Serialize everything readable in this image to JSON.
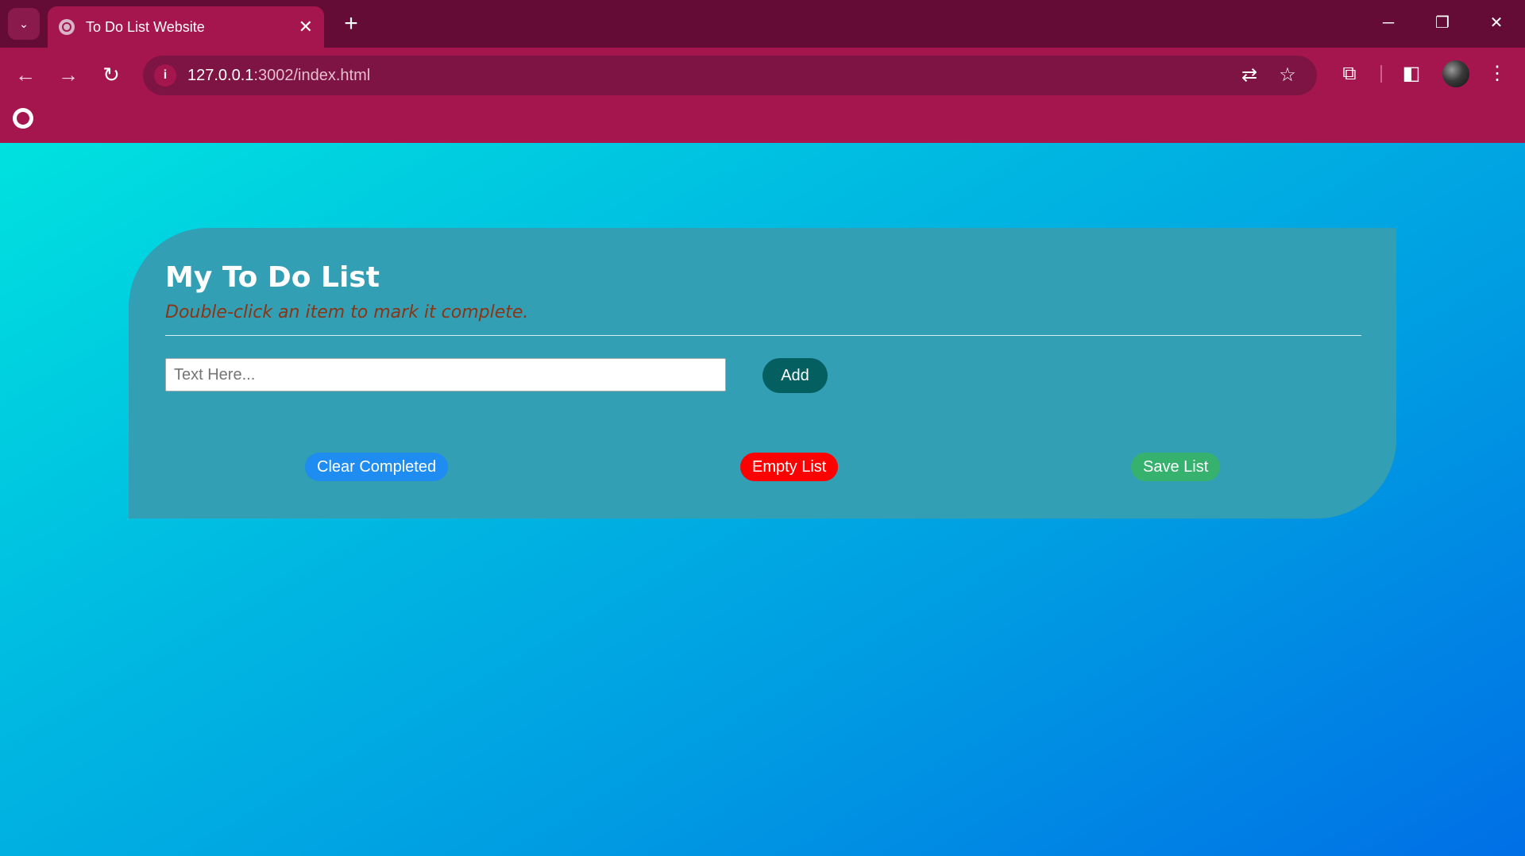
{
  "browser": {
    "tab_title": "To Do List Website",
    "tab_close": "✕",
    "new_tab": "+",
    "url_host": "127.0.0.1",
    "url_path": ":3002/index.html",
    "controls": {
      "minimize": "─",
      "restore": "❐",
      "close": "✕"
    },
    "nav": {
      "back": "←",
      "forward": "→",
      "reload": "↻"
    },
    "icons": {
      "site_info": "i",
      "translate": "⇄",
      "bookmark_star": "☆",
      "extensions": "⧉",
      "side_panel": "◧",
      "menu": "⋮",
      "tab_search": "⌄"
    }
  },
  "todo": {
    "title": "My To Do List",
    "subtitle": "Double-click an item to mark it complete.",
    "input_placeholder": "Text Here...",
    "input_value": "",
    "add_label": "Add",
    "clear_label": "Clear Completed",
    "empty_label": "Empty List",
    "save_label": "Save List",
    "items": []
  },
  "colors": {
    "chrome_dark": "#650c36",
    "chrome": "#a5164f",
    "panel": "#339fb4",
    "add_button": "#045f61",
    "clear_button": "#1e8cf0",
    "empty_button": "#ff0000",
    "save_button": "#37b26e",
    "subtitle_text": "#8b3514"
  }
}
